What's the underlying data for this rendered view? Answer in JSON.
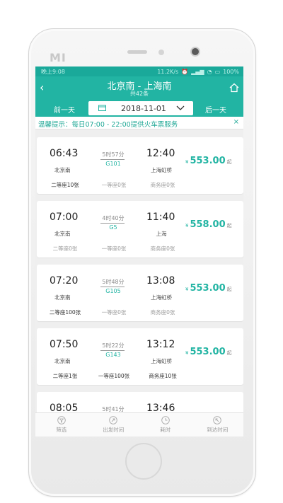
{
  "status_bar": {
    "left": "晚上9:08",
    "right": [
      "11.2K/s",
      "100%"
    ]
  },
  "header": {
    "title": "北京南 - 上海南",
    "subtitle": "共42条"
  },
  "date_bar": {
    "prev": "前一天",
    "date": "2018-11-01",
    "next": "后一天"
  },
  "notice": {
    "text": "温馨提示：每日07:00 - 22:00提供火车票服务",
    "close": "×"
  },
  "currency": "¥",
  "price_suffix": "起",
  "trains": [
    {
      "depart_time": "06:43",
      "depart_station": "北京南",
      "duration": "5时57分",
      "train_no": "G101",
      "arrive_time": "12:40",
      "arrive_station": "上海虹桥",
      "price": "553.00",
      "seats": [
        {
          "text": "二等座10张",
          "available": true
        },
        {
          "text": "一等座0张",
          "available": false
        },
        {
          "text": "商务座0张",
          "available": false
        }
      ]
    },
    {
      "depart_time": "07:00",
      "depart_station": "北京南",
      "duration": "4时40分",
      "train_no": "G5",
      "arrive_time": "11:40",
      "arrive_station": "上海",
      "price": "558.00",
      "seats": [
        {
          "text": "二等座0张",
          "available": false
        },
        {
          "text": "一等座0张",
          "available": false
        },
        {
          "text": "商务座0张",
          "available": false
        }
      ]
    },
    {
      "depart_time": "07:20",
      "depart_station": "北京南",
      "duration": "5时48分",
      "train_no": "G105",
      "arrive_time": "13:08",
      "arrive_station": "上海虹桥",
      "price": "553.00",
      "seats": [
        {
          "text": "二等座100张",
          "available": true
        },
        {
          "text": "一等座0张",
          "available": false
        },
        {
          "text": "商务座0张",
          "available": false
        }
      ]
    },
    {
      "depart_time": "07:50",
      "depart_station": "北京南",
      "duration": "5时22分",
      "train_no": "G143",
      "arrive_time": "13:12",
      "arrive_station": "上海虹桥",
      "price": "553.00",
      "seats": [
        {
          "text": "二等座1张",
          "available": true
        },
        {
          "text": "一等座100张",
          "available": true
        },
        {
          "text": "商务座10张",
          "available": true
        }
      ]
    },
    {
      "depart_time": "08:05",
      "depart_station": "",
      "duration": "5时41分",
      "train_no": "",
      "arrive_time": "13:46",
      "arrive_station": "",
      "price": "",
      "seats": []
    }
  ],
  "tabbar": [
    {
      "label": "筛选",
      "icon": "filter-icon"
    },
    {
      "label": "出发时间",
      "icon": "departure-time-icon"
    },
    {
      "label": "耗时",
      "icon": "clock-icon"
    },
    {
      "label": "到达时间",
      "icon": "arrival-time-icon"
    }
  ],
  "colors": {
    "accent": "#22b4a3",
    "status_bar": "#1aa99a"
  },
  "device": {
    "logo": "MI"
  }
}
